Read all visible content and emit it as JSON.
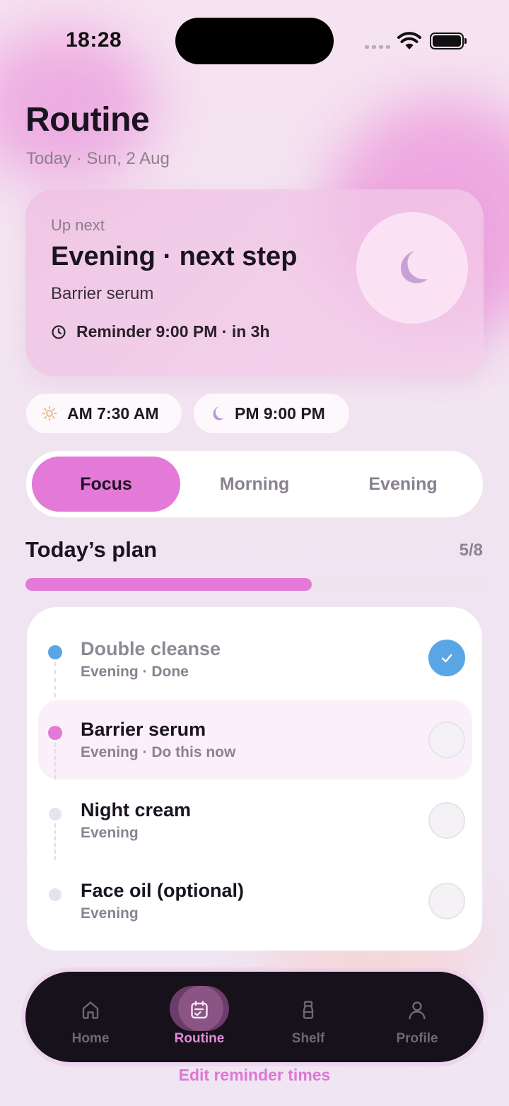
{
  "status_bar": {
    "time": "18:28"
  },
  "header": {
    "title": "Routine",
    "subtitle": "Today · Sun, 2 Aug"
  },
  "up_next": {
    "label": "Up next",
    "title": "Evening · next step",
    "product": "Barrier serum",
    "reminder": "Reminder 9:00 PM · in 3h",
    "icon": "moon-icon"
  },
  "schedule": {
    "am": {
      "label": "AM 7:30 AM",
      "icon": "sun-icon"
    },
    "pm": {
      "label": "PM 9:00 PM",
      "icon": "moon-icon"
    }
  },
  "segments": [
    {
      "label": "Focus",
      "active": true
    },
    {
      "label": "Morning",
      "active": false
    },
    {
      "label": "Evening",
      "active": false
    }
  ],
  "plan": {
    "title": "Today’s plan",
    "count": "5/8",
    "progress": 0.625,
    "steps": [
      {
        "name": "Double cleanse",
        "meta": "Evening · Done",
        "status": "done"
      },
      {
        "name": "Barrier serum",
        "meta": "Evening · Do this now",
        "status": "current"
      },
      {
        "name": "Night cream",
        "meta": "Evening",
        "status": "pending"
      },
      {
        "name": "Face oil (optional)",
        "meta": "Evening",
        "status": "pending"
      }
    ]
  },
  "tabbar": {
    "items": [
      {
        "label": "Home",
        "icon": "home-icon",
        "active": false
      },
      {
        "label": "Routine",
        "icon": "routine-icon",
        "active": true
      },
      {
        "label": "Shelf",
        "icon": "bottle-icon",
        "active": false
      },
      {
        "label": "Profile",
        "icon": "person-icon",
        "active": false
      }
    ]
  },
  "footer": {
    "edit_link": "Edit reminder times"
  },
  "colors": {
    "accent": "#e37ad7",
    "done": "#5aa6e4",
    "tabbar": "#16111a"
  }
}
